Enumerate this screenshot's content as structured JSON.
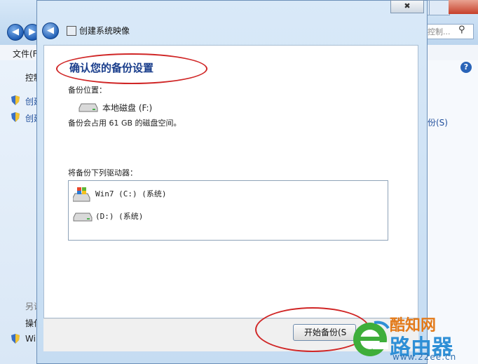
{
  "background_window": {
    "menu_file": "文件(F",
    "search_placeholder": "搜索控制...",
    "left_text_1": "控制",
    "left_link_1": "创建",
    "left_link_2": "创建",
    "left_text_2": "另请",
    "left_text_3": "操作",
    "left_text_4": "Wi",
    "right_link": "备份(S)"
  },
  "dialog": {
    "title": "创建系统映像",
    "heading": "确认您的备份设置",
    "backup_location_label": "备份位置：",
    "backup_location_drive": "本地磁盘 (F:)",
    "backup_space_text": "备份会占用 61 GB 的磁盘空间。",
    "drives_label": "将备份下列驱动器：",
    "drives": [
      {
        "label": "Win7 (C:) (系统)"
      },
      {
        "label": "(D:) (系统)"
      }
    ],
    "start_button": "开始备份(S"
  },
  "watermark": {
    "line1": "酷知网",
    "line2": "路由器",
    "url": "www.22ee.cn"
  },
  "colors": {
    "annotation_red": "#d02626",
    "heading_blue": "#1a3e8c"
  }
}
